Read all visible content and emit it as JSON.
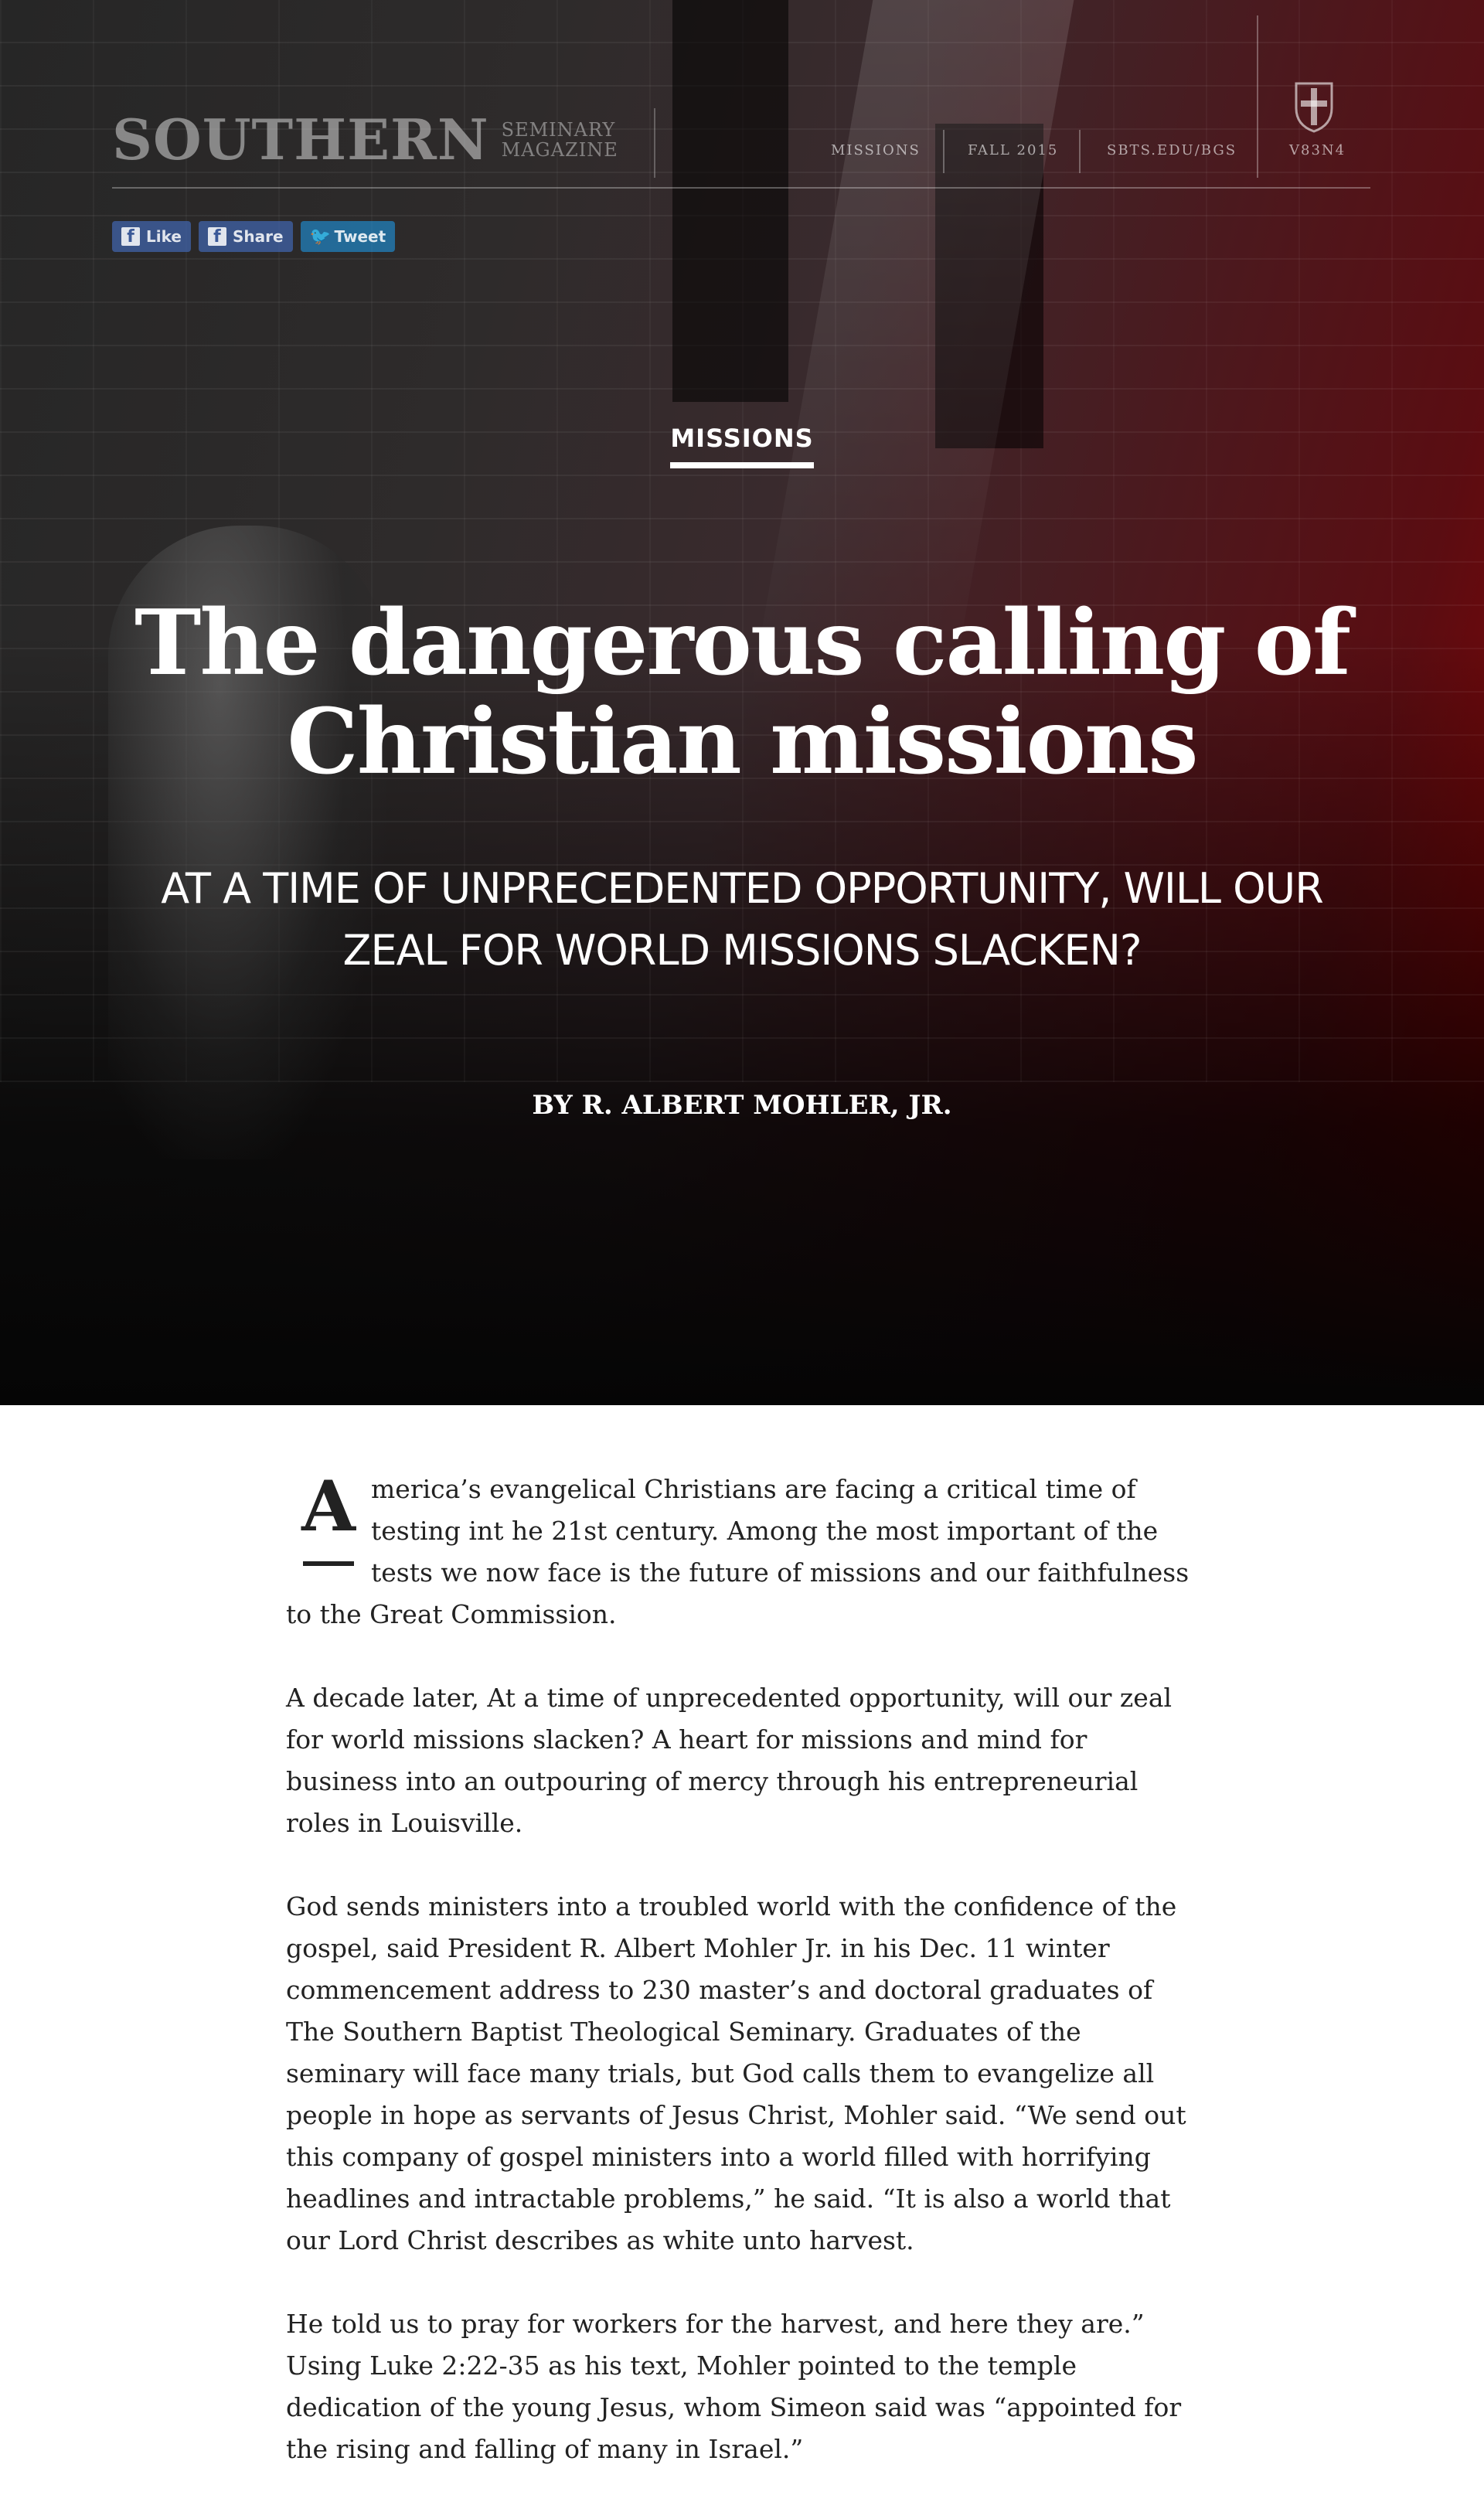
{
  "header": {
    "brand_main": "SOUTHERN",
    "brand_sub_line1": "SEMINARY",
    "brand_sub_line2": "MAGAZINE",
    "nav": [
      "MISSIONS",
      "FALL 2015",
      "SBTS.EDU/BGS"
    ],
    "volume": "V83N4"
  },
  "social": {
    "like": "Like",
    "share": "Share",
    "tweet": "Tweet"
  },
  "hero": {
    "category": "MISSIONS",
    "title_line1": "The dangerous calling of",
    "title_line2": "Christian missions",
    "subtitle_line1": "AT A TIME OF UNPRECEDENTED OPPORTUNITY, WILL OUR",
    "subtitle_line2": "ZEAL FOR WORLD MISSIONS SLACKEN?",
    "byline": "BY R. ALBERT MOHLER, JR."
  },
  "article": {
    "drop_cap": "A",
    "p1_rest": "merica’s evangelical Christians are facing a critical time of testing int he 21st century. Among the most important of the tests we now face is the future of missions and our faithfulness to the Great Commission.",
    "p2": "A decade later, At a time of unprecedented opportunity, will our zeal for world missions slacken? A heart for missions and mind for business into an outpouring of mercy through his entrepreneurial roles in Louisville.",
    "p3": "God sends ministers into a troubled world with the confidence of the gospel, said President R. Albert Mohler Jr. in his Dec. 11 winter commencement address to 230 master’s and doctoral graduates of The Southern Baptist Theological Seminary. Graduates of the seminary will face many trials, but God calls them to evangelize all people in hope as servants of Jesus Christ, Mohler said. “We send out this company of gospel ministers into a world filled with horrifying headlines and intractable problems,” he said. “It is also a world that our Lord Christ describes as white unto harvest.",
    "p4": "He told us to pray for workers for the harvest, and here they are.” Using Luke 2:22-35 as his text, Mohler pointed to the temple dedication of the young Jesus, whom Simeon said was “appointed for the rising and falling of many in Israel.”"
  }
}
